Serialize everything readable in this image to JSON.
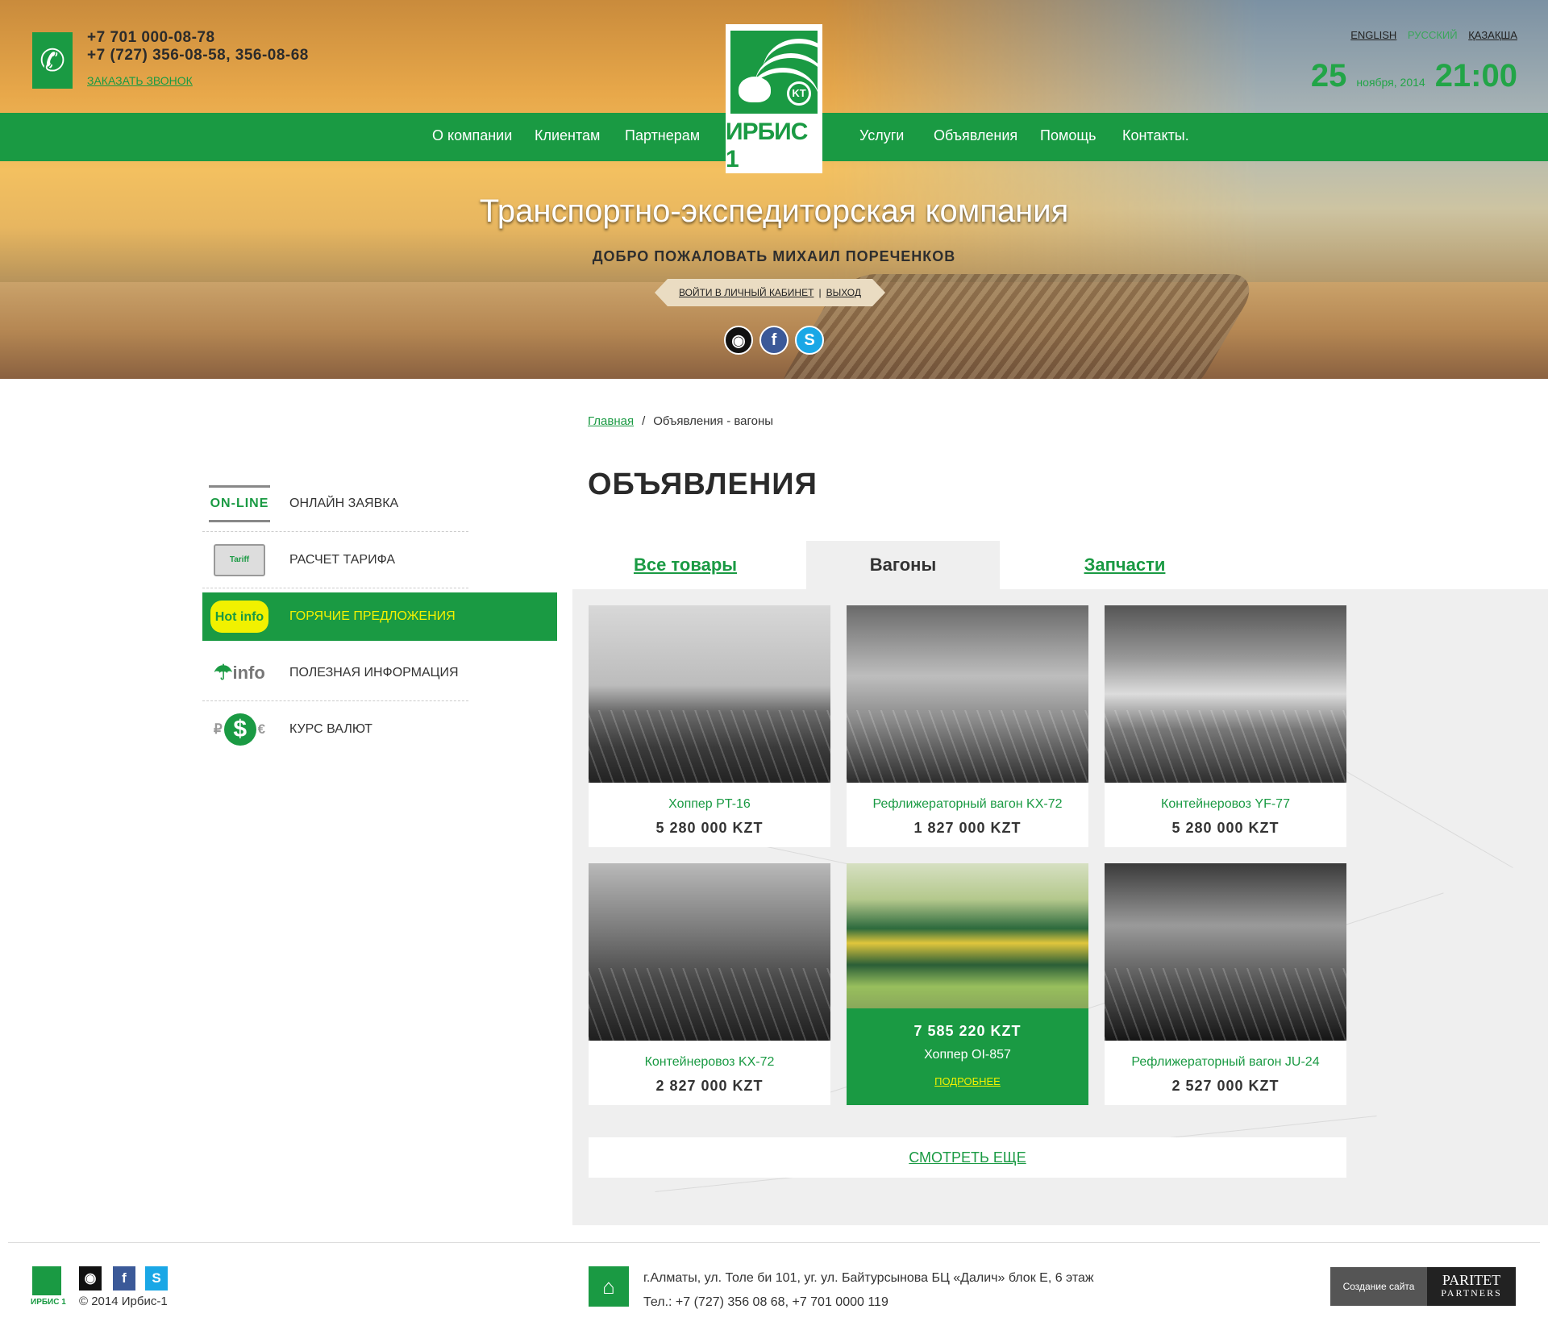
{
  "header": {
    "phone1": "+7 701 000-08-78",
    "phone2": "+7 (727) 356-08-58, 356-08-68",
    "callback": "ЗАКАЗАТЬ ЗВОНОК",
    "icons": {
      "phone": "phone-icon"
    },
    "languages": [
      "ENGLISH",
      "РУССКИЙ",
      "ҚАЗАҚША"
    ],
    "active_language": "РУССКИЙ",
    "date_day": "25",
    "date_month": "ноября, 2014",
    "time": "21:00",
    "logo_text": "ИРБИС 1",
    "logo_badge": "KT"
  },
  "nav": [
    "О компании",
    "Клиентам",
    "Партнерам",
    "Услуги",
    "Объявления",
    "Помощь",
    "Контакты."
  ],
  "hero": {
    "tagline": "Транспортно-экспедиторская компания",
    "welcome": "ДОБРО ПОЖАЛОВАТЬ МИХАИЛ ПОРЕЧЕНКОВ",
    "cabinet": "ВОЙТИ В ЛИЧНЫЙ КАБИНЕТ",
    "logout": "ВЫХОД"
  },
  "breadcrumb": {
    "home": "Главная",
    "current": "Объявления - вагоны"
  },
  "sidebar": [
    {
      "label": "ОНЛАЙН ЗАЯВКА",
      "icon": "ON-LINE"
    },
    {
      "label": "РАСЧЕТ ТАРИФА",
      "icon": "Tariff"
    },
    {
      "label": "ГОРЯЧИЕ ПРЕДЛОЖЕНИЯ",
      "icon": "Hot info",
      "active": true
    },
    {
      "label": "ПОЛЕЗНАЯ ИНФОРМАЦИЯ",
      "icon": "info"
    },
    {
      "label": "КУРС ВАЛЮТ",
      "icon": "$"
    }
  ],
  "page_title": "ОБЪЯВЛЕНИЯ",
  "tabs": [
    "Все товары",
    "Вагоны",
    "Запчасти"
  ],
  "selected_tab": "Вагоны",
  "cards": [
    {
      "title": "Хоппер PT-16",
      "price": "5 280 000 KZT"
    },
    {
      "title": "Рефлижераторный вагон KX-72",
      "price": "1 827 000  KZT"
    },
    {
      "title": "Контейнеровоз YF-77",
      "price": "5 280 000 KZT"
    },
    {
      "title": "Контейнеровоз KX-72",
      "price": "2 827 000  KZT"
    },
    {
      "title": "Хоппер OI-857",
      "price": "7 585 220 KZT",
      "more": "ПОДРОБНЕЕ",
      "highlighted": true
    },
    {
      "title": "Рефлижераторный вагон JU-24",
      "price": "2 527 000  KZT"
    }
  ],
  "show_more": "СМОТРЕТЬ ЕЩЕ",
  "footer": {
    "logo_text": "ИРБИС 1",
    "copyright": "© 2014  Ирбис-1",
    "address": "г.Алматы, ул. Толе би 101, уг. ул. Байтурсынова БЦ «Далич» блок Е, 6 этаж",
    "phones": "Тел.: +7 (727) 356 08 68, +7 701 0000 119",
    "dev_label": "Создание сайта",
    "dev_brand": "PARITET",
    "dev_brand_sub": "PARTNERS"
  },
  "colors": {
    "brand_green": "#1a9a43",
    "highlight_yellow": "#f1f100"
  }
}
